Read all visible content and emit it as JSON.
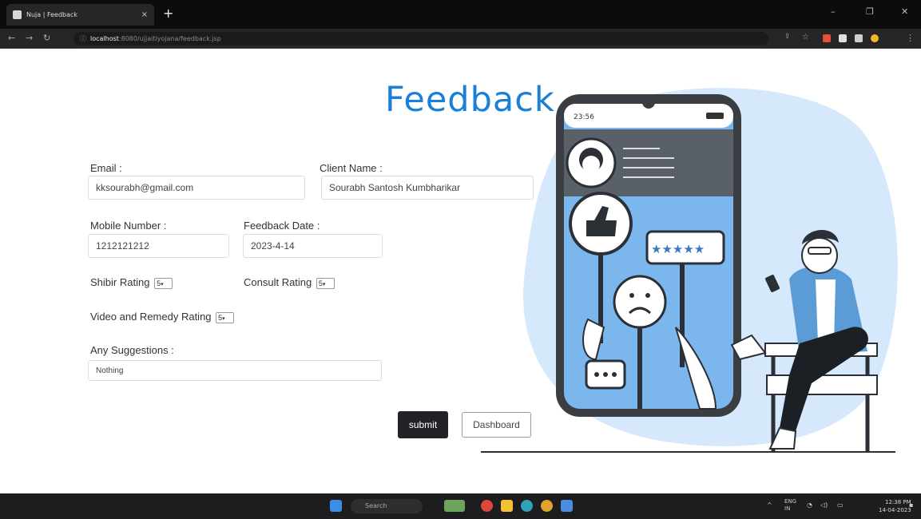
{
  "browser": {
    "tab_title": "Nuja | Feedback",
    "tab_close": "×",
    "new_tab": "+",
    "url_host": "localhost",
    "url_path": ":8080/ujjaitiyojana/feedback.jsp",
    "win_minimize": "–",
    "win_restore": "❐",
    "win_close": "✕"
  },
  "page": {
    "title": "Feedback",
    "form": {
      "email_label": "Email :",
      "email_value": "kksourabh@gmail.com",
      "client_name_label": "Client Name :",
      "client_name_value": "Sourabh Santosh Kumbharikar",
      "mobile_label": "Mobile Number :",
      "mobile_value": "1212121212",
      "feedback_date_label": "Feedback Date :",
      "feedback_date_value": "2023-4-14",
      "shibir_label": "Shibir Rating",
      "shibir_value": "5",
      "consult_label": "Consult Rating",
      "consult_value": "5",
      "video_label": "Video and Remedy Rating",
      "video_value": "5",
      "suggestions_label": "Any Suggestions :",
      "suggestions_value": "Nothing",
      "submit_label": "submit",
      "dashboard_label": "Dashboard"
    },
    "phone_time": "23:56"
  },
  "taskbar": {
    "search_placeholder": "Search",
    "lang": "ENG",
    "lang_region": "IN",
    "time": "12:38 PM",
    "date": "14-04-2023"
  },
  "colors": {
    "accent": "#1a7fd8",
    "illustration_blob": "#d6e8fb",
    "phone_screen": "#7bb7ec",
    "submit_bg": "#202225"
  }
}
